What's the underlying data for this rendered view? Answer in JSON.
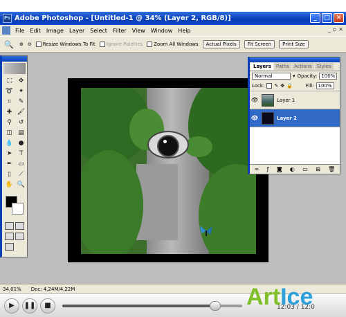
{
  "window": {
    "title": "Adobe Photoshop - [Untitled-1 @ 34% (Layer 2, RGB/8)]"
  },
  "menu": [
    "File",
    "Edit",
    "Image",
    "Layer",
    "Select",
    "Filter",
    "View",
    "Window",
    "Help"
  ],
  "options_bar": {
    "resize_windows": "Resize Windows To Fit",
    "ignore_palettes": "Ignore Palettes",
    "zoom_all_windows": "Zoom All Windows",
    "actual_pixels": "Actual Pixels",
    "fit_screen": "Fit Screen",
    "print_size": "Print Size"
  },
  "layers_panel": {
    "tabs": [
      "Layers",
      "Paths",
      "Actions",
      "Styles"
    ],
    "blend_mode": "Normal",
    "opacity_label": "Opacity:",
    "opacity_value": "100%",
    "lock_label": "Lock:",
    "fill_label": "Fill:",
    "fill_value": "100%",
    "layers": [
      {
        "name": "Layer 1",
        "visible": true,
        "active": false
      },
      {
        "name": "Layer 2",
        "visible": true,
        "active": true
      }
    ]
  },
  "status_bar": {
    "zoom": "34,01%",
    "doc": "Doc: 4,24M/4,22M"
  },
  "player": {
    "time": "12:03 / 12:0",
    "progress": 0.85
  },
  "watermark": {
    "part1": "Art",
    "part2": "Ice"
  },
  "colors": {
    "title_bar": "#0a3fb8",
    "layer_selected": "#3169c6",
    "foreground": "#000000",
    "background": "#ffffff"
  }
}
